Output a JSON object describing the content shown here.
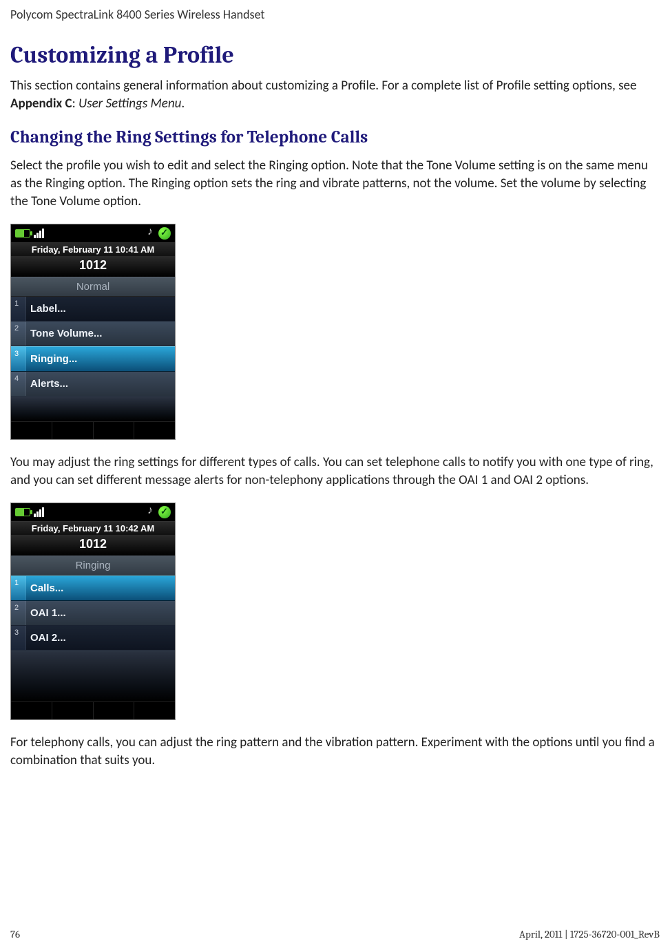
{
  "header": {
    "title": "Polycom SpectraLink 8400 Series Wireless Handset"
  },
  "sections": {
    "h1": "Customizing a Profile",
    "intro_pre": "This section contains general information about customizing a Profile. For a complete list of Profile setting options, see ",
    "intro_bold": "Appendix C",
    "intro_mid": ": ",
    "intro_em": "User Settings Menu",
    "intro_post": ".",
    "h2": "Changing the Ring Settings for Telephone Calls",
    "para1": "Select the profile you wish to edit and select the Ringing option. Note that the Tone Volume setting is on the same menu as the Ringing option. The Ringing option sets the ring and vibrate patterns, not the volume. Set the volume by selecting the Tone Volume option.",
    "para2": "You may adjust the ring settings for different types of calls. You can set telephone calls to notify you with one type of ring, and you can set different message alerts for non-telephony applications through the OAI 1 and OAI 2 options.",
    "para3": "For telephony calls, you can adjust the ring pattern and the vibration pattern. Experiment with the options until you find a combination that suits you."
  },
  "phone1": {
    "date": "Friday, February 11 10:41 AM",
    "ext": "1012",
    "screen_title": "Normal",
    "items": [
      {
        "num": "1",
        "label": "Label...",
        "style": "dark"
      },
      {
        "num": "2",
        "label": "Tone Volume...",
        "style": "steel"
      },
      {
        "num": "3",
        "label": "Ringing...",
        "style": "sel"
      },
      {
        "num": "4",
        "label": "Alerts...",
        "style": "steel"
      }
    ],
    "spacer_height": 36
  },
  "phone2": {
    "date": "Friday, February 11 10:42 AM",
    "ext": "1012",
    "screen_title": "Ringing",
    "items": [
      {
        "num": "1",
        "label": "Calls...",
        "style": "sel"
      },
      {
        "num": "2",
        "label": "OAI 1...",
        "style": "steel"
      },
      {
        "num": "3",
        "label": "OAI 2...",
        "style": "dark"
      }
    ],
    "spacer_height": 74
  },
  "footer": {
    "page": "76",
    "right": "April, 2011  |  1725-36720-001_RevB"
  }
}
